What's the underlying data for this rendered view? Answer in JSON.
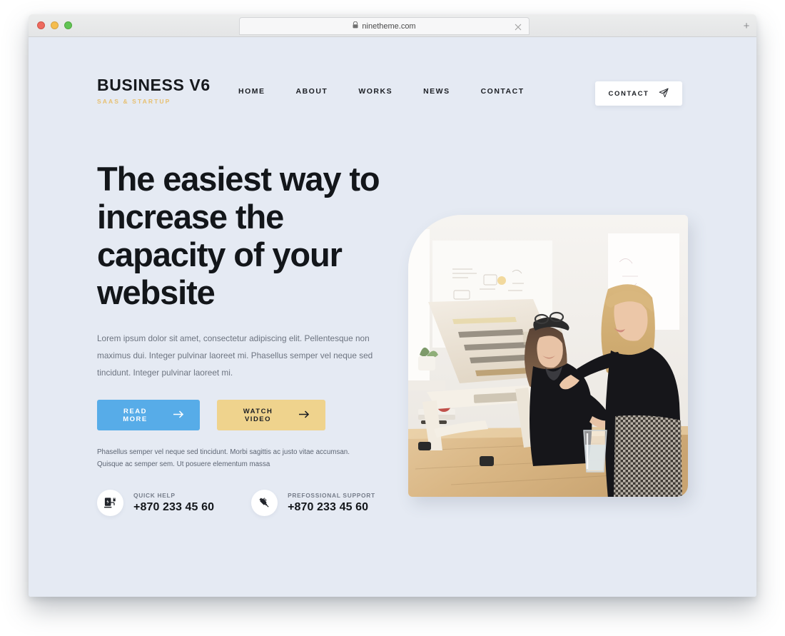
{
  "browser": {
    "url": "ninetheme.com",
    "lock_icon": "lock-icon",
    "close_tab_icon": "close-icon",
    "new_tab_label": "+",
    "traffic_lights": [
      "close",
      "minimize",
      "maximize"
    ]
  },
  "header": {
    "brand_name": "BUSINESS V6",
    "brand_tagline": "SAAS & STARTUP",
    "nav": [
      {
        "label": "HOME"
      },
      {
        "label": "ABOUT"
      },
      {
        "label": "WORKS"
      },
      {
        "label": "NEWS"
      },
      {
        "label": "CONTACT"
      }
    ],
    "cta": {
      "label": "CONTACT",
      "icon": "paper-plane-icon"
    }
  },
  "hero": {
    "title": "The easiest way to increase the capacity of your website",
    "description": "Lorem ipsum dolor sit amet, consectetur adipiscing elit. Pellentesque non maximus dui. Integer pulvinar laoreet mi. Phasellus semper vel neque sed tincidunt. Integer pulvinar laoreet mi.",
    "buttons": {
      "primary": {
        "label": "READ MORE",
        "icon": "arrow-right-icon"
      },
      "secondary": {
        "label": "WATCH VIDEO",
        "icon": "arrow-right-icon"
      }
    },
    "note": "Phasellus semper vel neque sed tincidunt. Morbi sagittis ac justo vitae accumsan. Quisque ac semper sem. Ut posuere elementum massa",
    "contacts": [
      {
        "icon": "charging-station-icon",
        "label": "QUICK HELP",
        "phone": "+870 233 45 60"
      },
      {
        "icon": "syringe-icon",
        "label": "PREFOSSIONAL SUPPORT",
        "phone": "+870 233 45 60"
      }
    ],
    "image_alt": "two-women-working-at-standing-desk-with-laptop-stand"
  },
  "colors": {
    "page_background": "#e5eaf3",
    "accent_blue": "#57ace8",
    "accent_gold": "#efd38d",
    "brand_tag_gold": "#e7c071",
    "heading": "#13161a",
    "body_text": "#6d7480"
  }
}
